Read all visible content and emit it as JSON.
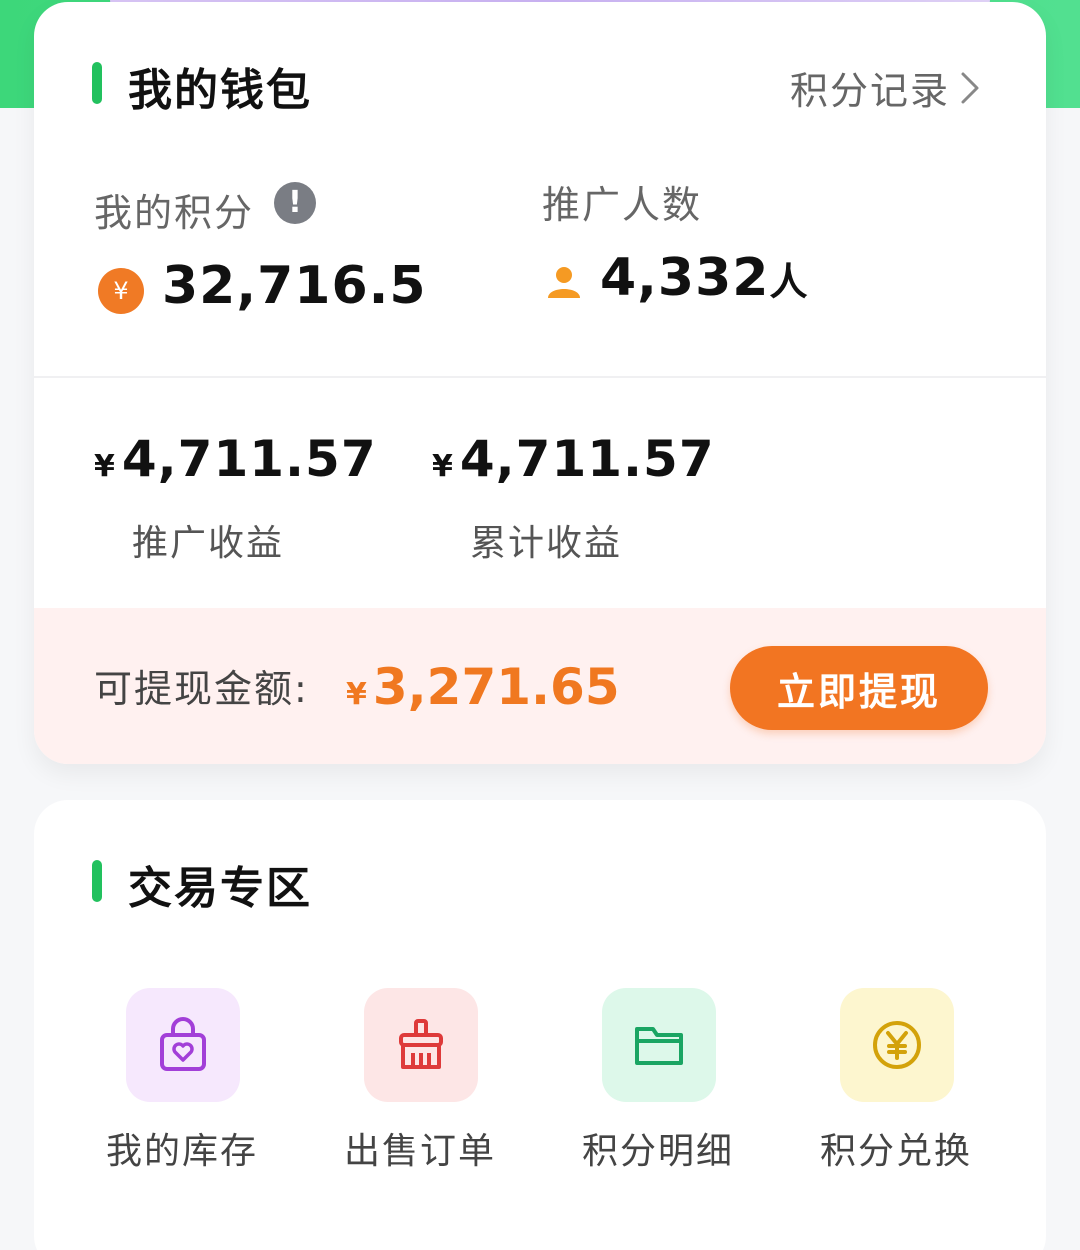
{
  "wallet": {
    "title": "我的钱包",
    "record_link": "积分记录",
    "points_label": "我的积分",
    "points_value": "32,716.5",
    "coin_symbol": "¥",
    "promo_count_label": "推广人数",
    "promo_count_value": "4,332",
    "promo_count_unit": "人",
    "promo_income": {
      "currency": "¥",
      "value": "4,711.57",
      "label": "推广收益"
    },
    "total_income": {
      "currency": "¥",
      "value": "4,711.57",
      "label": "累计收益"
    },
    "withdrawable_label": "可提现金额:",
    "withdrawable_currency": "¥",
    "withdrawable_value": "3,271.65",
    "withdraw_button": "立即提现"
  },
  "trade": {
    "title": "交易专区",
    "items": [
      {
        "label": "我的库存",
        "icon": "shopping-bag-heart-icon",
        "bg": "#f6e8fd",
        "color": "#a23fd8"
      },
      {
        "label": "出售订单",
        "icon": "broom-icon",
        "bg": "#fde6e6",
        "color": "#de3a3a"
      },
      {
        "label": "积分明细",
        "icon": "folder-icon",
        "bg": "#ddf8ea",
        "color": "#1aa563"
      },
      {
        "label": "积分兑换",
        "icon": "yen-coin-icon",
        "bg": "#fdf6cf",
        "color": "#d3a20a"
      }
    ]
  },
  "colors": {
    "accent_green": "#22c15e",
    "accent_orange": "#f27522",
    "withdraw_band": "#fff1f0"
  }
}
